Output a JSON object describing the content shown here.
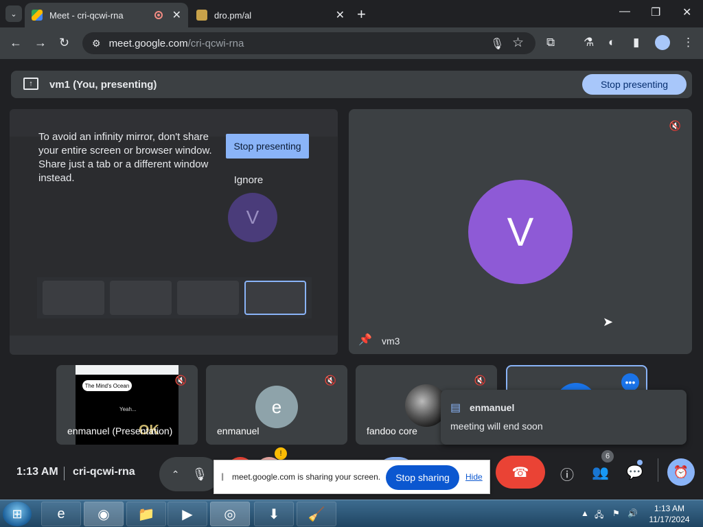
{
  "browser": {
    "tabs": [
      {
        "title": "Meet - cri-qcwi-rna",
        "active": true
      },
      {
        "title": "dro.pm/al",
        "active": false
      }
    ],
    "new_tab_glyph": "+",
    "address": {
      "host": "meet.google.com",
      "path": "/cri-qcwi-rna"
    }
  },
  "meet": {
    "presenting_banner": {
      "text": "vm1 (You, presenting)",
      "stop_label": "Stop presenting"
    },
    "share_preview": {
      "message": "To avoid an infinity mirror, don't share your entire screen or browser window. Share just a tab or a different window instead.",
      "stop_label": "Stop presenting",
      "ignore_label": "Ignore",
      "ghost_avatar_letter": "V"
    },
    "main_tile": {
      "name": "vm3",
      "avatar_letter": "V",
      "avatar_color": "#8e5ad6"
    },
    "participants": [
      {
        "name": "enmanuel (Presentation)",
        "slide_title": "The Mind's Ocean",
        "slide_sub": "Yeah...",
        "slide_ok": "OK"
      },
      {
        "name": "enmanuel",
        "avatar_letter": "e",
        "avatar_color": "#8ea3aa"
      },
      {
        "name": "fandoo core"
      }
    ],
    "chat_toast": {
      "sender": "enmanuel",
      "message": "meeting will end soon"
    },
    "controls": {
      "time": "1:13 AM",
      "meeting_code": "cri-qcwi-rna",
      "people_count": "6"
    },
    "share_banner": {
      "text": "meet.google.com is sharing your screen.",
      "stop_label": "Stop sharing",
      "hide_label": "Hide"
    }
  },
  "taskbar": {
    "time": "1:13 AM",
    "date": "11/17/2024"
  },
  "colors": {
    "accent": "#8ab4f8",
    "leave": "#ea4335",
    "surface": "#3c4043",
    "background": "#202124"
  }
}
